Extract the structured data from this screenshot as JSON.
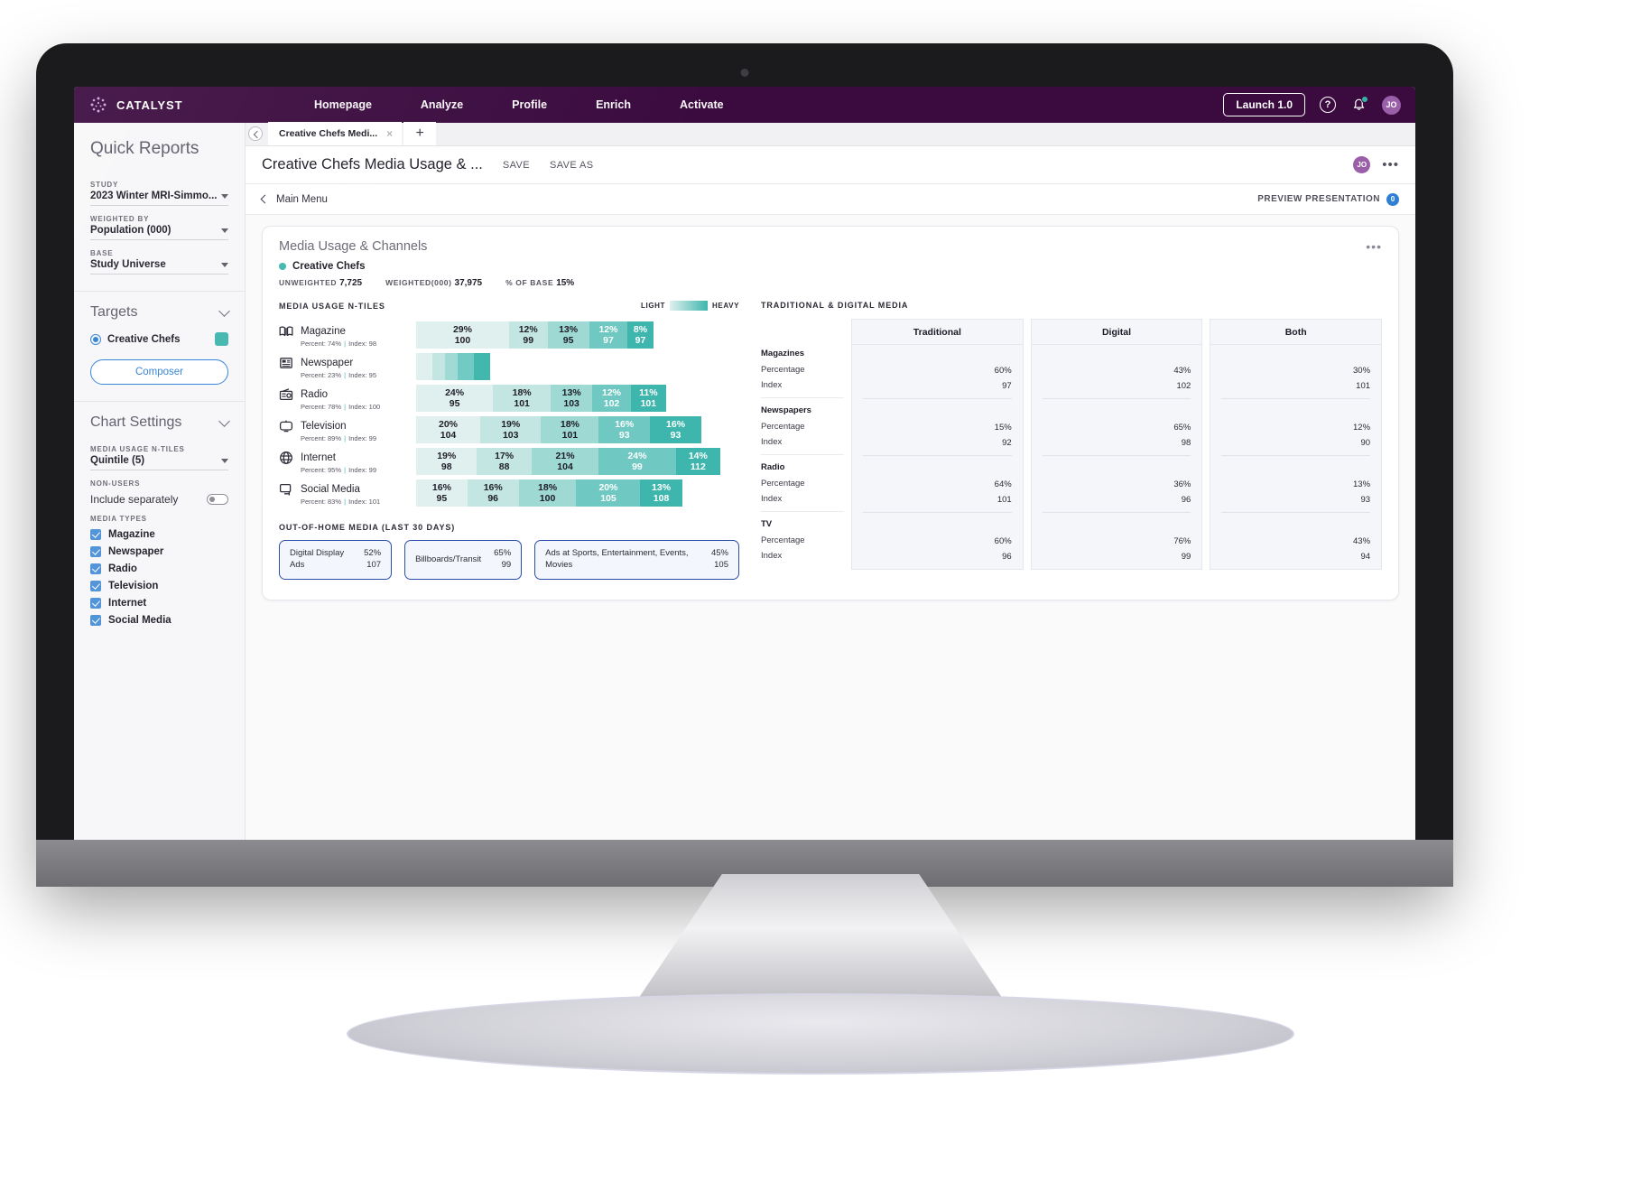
{
  "topnav": {
    "brand": "CATALYST",
    "links": [
      "Homepage",
      "Analyze",
      "Profile",
      "Enrich",
      "Activate"
    ],
    "launch_button": "Launch 1.0",
    "help_icon": "?",
    "avatar_initials": "JO"
  },
  "sidebar": {
    "title": "Quick Reports",
    "fields": [
      {
        "label": "STUDY",
        "value": "2023 Winter MRI-Simmo..."
      },
      {
        "label": "WEIGHTED BY",
        "value": "Population (000)"
      },
      {
        "label": "BASE",
        "value": "Study Universe"
      }
    ],
    "targets": {
      "title": "Targets",
      "item": "Creative Chefs",
      "swatch_color": "#3fb6ad",
      "composer_button": "Composer"
    },
    "chart_settings": {
      "title": "Chart Settings",
      "ntiles_label": "MEDIA USAGE N-TILES",
      "ntiles_value": "Quintile (5)",
      "nonusers_label": "NON-USERS",
      "nonusers_value": "Include separately",
      "media_types_label": "MEDIA TYPES",
      "media_types": [
        {
          "label": "Magazine",
          "checked": true
        },
        {
          "label": "Newspaper",
          "checked": true
        },
        {
          "label": "Radio",
          "checked": true
        },
        {
          "label": "Television",
          "checked": true
        },
        {
          "label": "Internet",
          "checked": true
        },
        {
          "label": "Social Media",
          "checked": true
        }
      ]
    }
  },
  "tabs": {
    "open_tab": "Creative Chefs Medi...",
    "close_glyph": "×",
    "add_glyph": "+"
  },
  "doc": {
    "title": "Creative Chefs Media Usage & ...",
    "save": "SAVE",
    "save_as": "SAVE AS",
    "avatar_initials": "JO",
    "more_glyph": "•••"
  },
  "subbar": {
    "main_menu": "Main Menu",
    "preview_label": "PREVIEW PRESENTATION",
    "preview_count": "0"
  },
  "card": {
    "title": "Media Usage & Channels",
    "more_glyph": "•••",
    "target_name": "Creative Chefs",
    "target_color": "#3fb6ad",
    "stats": [
      {
        "label": "UNWEIGHTED",
        "value": "7,725"
      },
      {
        "label": "WEIGHTED(000)",
        "value": "37,975"
      },
      {
        "label": "% OF BASE",
        "value": "15%"
      }
    ]
  },
  "chart_data": [
    {
      "type": "bar",
      "title": "MEDIA USAGE N-TILES",
      "subtype": "stacked-100-horizontal",
      "legend": {
        "low_label": "LIGHT",
        "high_label": "HEAVY",
        "gradient": [
          "#dff0ee",
          "#3fb6ad"
        ],
        "position": "top-right"
      },
      "segment_colors": [
        "#dff0ee",
        "#c3e6e2",
        "#9ed9d3",
        "#6fc9c2",
        "#3fb6ad"
      ],
      "rows": [
        {
          "name": "Magazine",
          "icon": "magazine-icon",
          "sub": "Percent: 74% | Index: 98",
          "percent": "74%",
          "index": "98",
          "segments": [
            {
              "pct": 29,
              "pct_label": "29%",
              "index": "100"
            },
            {
              "pct": 12,
              "pct_label": "12%",
              "index": "99"
            },
            {
              "pct": 13,
              "pct_label": "13%",
              "index": "95"
            },
            {
              "pct": 12,
              "pct_label": "12%",
              "index": "97"
            },
            {
              "pct": 8,
              "pct_label": "8%",
              "index": "97"
            }
          ]
        },
        {
          "name": "Newspaper",
          "icon": "newspaper-icon",
          "sub": "Percent: 23% | Index: 95",
          "percent": "23%",
          "index": "95",
          "segments": [
            {
              "pct": 5,
              "pct_label": "",
              "index": ""
            },
            {
              "pct": 4,
              "pct_label": "",
              "index": ""
            },
            {
              "pct": 4,
              "pct_label": "",
              "index": ""
            },
            {
              "pct": 5,
              "pct_label": "",
              "index": ""
            },
            {
              "pct": 5,
              "pct_label": "",
              "index": ""
            }
          ]
        },
        {
          "name": "Radio",
          "icon": "radio-icon",
          "sub": "Percent: 78% | Index: 100",
          "percent": "78%",
          "index": "100",
          "segments": [
            {
              "pct": 24,
              "pct_label": "24%",
              "index": "95"
            },
            {
              "pct": 18,
              "pct_label": "18%",
              "index": "101"
            },
            {
              "pct": 13,
              "pct_label": "13%",
              "index": "103"
            },
            {
              "pct": 12,
              "pct_label": "12%",
              "index": "102"
            },
            {
              "pct": 11,
              "pct_label": "11%",
              "index": "101"
            }
          ]
        },
        {
          "name": "Television",
          "icon": "television-icon",
          "sub": "Percent: 89% | Index: 99",
          "percent": "89%",
          "index": "99",
          "segments": [
            {
              "pct": 20,
              "pct_label": "20%",
              "index": "104"
            },
            {
              "pct": 19,
              "pct_label": "19%",
              "index": "103"
            },
            {
              "pct": 18,
              "pct_label": "18%",
              "index": "101"
            },
            {
              "pct": 16,
              "pct_label": "16%",
              "index": "93"
            },
            {
              "pct": 16,
              "pct_label": "16%",
              "index": "93"
            }
          ]
        },
        {
          "name": "Internet",
          "icon": "internet-icon",
          "sub": "Percent: 95% | Index: 99",
          "percent": "95%",
          "index": "99",
          "segments": [
            {
              "pct": 19,
              "pct_label": "19%",
              "index": "98"
            },
            {
              "pct": 17,
              "pct_label": "17%",
              "index": "88"
            },
            {
              "pct": 21,
              "pct_label": "21%",
              "index": "104"
            },
            {
              "pct": 24,
              "pct_label": "24%",
              "index": "99"
            },
            {
              "pct": 14,
              "pct_label": "14%",
              "index": "112"
            }
          ]
        },
        {
          "name": "Social Media",
          "icon": "social-media-icon",
          "sub": "Percent: 83% | Index: 101",
          "percent": "83%",
          "index": "101",
          "segments": [
            {
              "pct": 16,
              "pct_label": "16%",
              "index": "95"
            },
            {
              "pct": 16,
              "pct_label": "16%",
              "index": "96"
            },
            {
              "pct": 18,
              "pct_label": "18%",
              "index": "100"
            },
            {
              "pct": 20,
              "pct_label": "20%",
              "index": "105"
            },
            {
              "pct": 13,
              "pct_label": "13%",
              "index": "108"
            }
          ]
        }
      ]
    },
    {
      "type": "table",
      "title": "TRADITIONAL & DIGITAL MEDIA",
      "columns": [
        "Traditional",
        "Digital",
        "Both"
      ],
      "row_labels": [
        "Percentage",
        "Index"
      ],
      "groups": [
        {
          "name": "Magazines",
          "Traditional": [
            "60%",
            "97"
          ],
          "Digital": [
            "43%",
            "102"
          ],
          "Both": [
            "30%",
            "101"
          ]
        },
        {
          "name": "Newspapers",
          "Traditional": [
            "15%",
            "92"
          ],
          "Digital": [
            "65%",
            "98"
          ],
          "Both": [
            "12%",
            "90"
          ]
        },
        {
          "name": "Radio",
          "Traditional": [
            "64%",
            "101"
          ],
          "Digital": [
            "36%",
            "96"
          ],
          "Both": [
            "13%",
            "93"
          ]
        },
        {
          "name": "TV",
          "Traditional": [
            "60%",
            "96"
          ],
          "Digital": [
            "76%",
            "99"
          ],
          "Both": [
            "43%",
            "94"
          ]
        }
      ]
    },
    {
      "type": "table",
      "title": "OUT-OF-HOME MEDIA (LAST 30 DAYS)",
      "cards": [
        {
          "name": "Digital Display Ads",
          "percent": "52%",
          "index": "107"
        },
        {
          "name": "Billboards/Transit",
          "percent": "65%",
          "index": "99"
        },
        {
          "name": "Ads at Sports, Entertainment, Events, Movies",
          "percent": "45%",
          "index": "105"
        }
      ]
    }
  ]
}
